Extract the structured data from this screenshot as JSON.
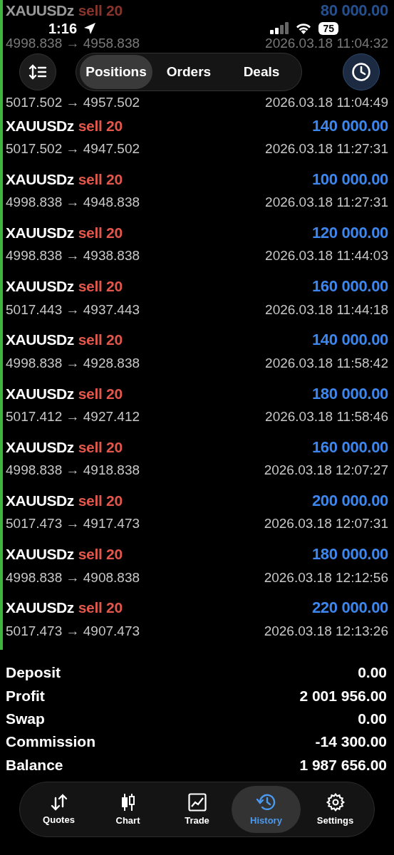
{
  "status_bar": {
    "time": "1:16",
    "battery": "75"
  },
  "header": {
    "tabs": [
      {
        "label": "Positions",
        "selected": true
      },
      {
        "label": "Orders",
        "selected": false
      },
      {
        "label": "Deals",
        "selected": false
      }
    ]
  },
  "deals": [
    {
      "faded": true,
      "symbol": "XAUUSDz",
      "side": "sell 20",
      "profit": "80 000.00",
      "prices": "4998.838 → 4958.838",
      "time": "2026.03.18 11:04:32"
    },
    {
      "faded": false,
      "prices": "5017.502 → 4957.502",
      "time": "2026.03.18 11:04:49"
    },
    {
      "faded": false,
      "symbol": "XAUUSDz",
      "side": "sell 20",
      "profit": "140 000.00",
      "prices": "5017.502 → 4947.502",
      "time": "2026.03.18 11:27:31"
    },
    {
      "faded": false,
      "symbol": "XAUUSDz",
      "side": "sell 20",
      "profit": "100 000.00",
      "prices": "4998.838 → 4948.838",
      "time": "2026.03.18 11:27:31"
    },
    {
      "faded": false,
      "symbol": "XAUUSDz",
      "side": "sell 20",
      "profit": "120 000.00",
      "prices": "4998.838 → 4938.838",
      "time": "2026.03.18 11:44:03"
    },
    {
      "faded": false,
      "symbol": "XAUUSDz",
      "side": "sell 20",
      "profit": "160 000.00",
      "prices": "5017.443 → 4937.443",
      "time": "2026.03.18 11:44:18"
    },
    {
      "faded": false,
      "symbol": "XAUUSDz",
      "side": "sell 20",
      "profit": "140 000.00",
      "prices": "4998.838 → 4928.838",
      "time": "2026.03.18 11:58:42"
    },
    {
      "faded": false,
      "symbol": "XAUUSDz",
      "side": "sell 20",
      "profit": "180 000.00",
      "prices": "5017.412 → 4927.412",
      "time": "2026.03.18 11:58:46"
    },
    {
      "faded": false,
      "symbol": "XAUUSDz",
      "side": "sell 20",
      "profit": "160 000.00",
      "prices": "4998.838 → 4918.838",
      "time": "2026.03.18 12:07:27"
    },
    {
      "faded": false,
      "symbol": "XAUUSDz",
      "side": "sell 20",
      "profit": "200 000.00",
      "prices": "5017.473 → 4917.473",
      "time": "2026.03.18 12:07:31"
    },
    {
      "faded": false,
      "symbol": "XAUUSDz",
      "side": "sell 20",
      "profit": "180 000.00",
      "prices": "4998.838 → 4908.838",
      "time": "2026.03.18 12:12:56"
    },
    {
      "faded": false,
      "symbol": "XAUUSDz",
      "side": "sell 20",
      "profit": "220 000.00",
      "prices": "5017.473 → 4907.473",
      "time": "2026.03.18 12:13:26"
    }
  ],
  "summary": [
    {
      "label": "Deposit",
      "value": "0.00"
    },
    {
      "label": "Profit",
      "value": "2 001 956.00"
    },
    {
      "label": "Swap",
      "value": "0.00"
    },
    {
      "label": "Commission",
      "value": "-14 300.00"
    },
    {
      "label": "Balance",
      "value": "1 987 656.00"
    }
  ],
  "tab_bar": [
    {
      "kind": "quotes",
      "label": "Quotes",
      "selected": false
    },
    {
      "kind": "chart",
      "label": "Chart",
      "selected": false
    },
    {
      "kind": "trade",
      "label": "Trade",
      "selected": false
    },
    {
      "kind": "history",
      "label": "History",
      "selected": true
    },
    {
      "kind": "settings",
      "label": "Settings",
      "selected": false
    }
  ]
}
